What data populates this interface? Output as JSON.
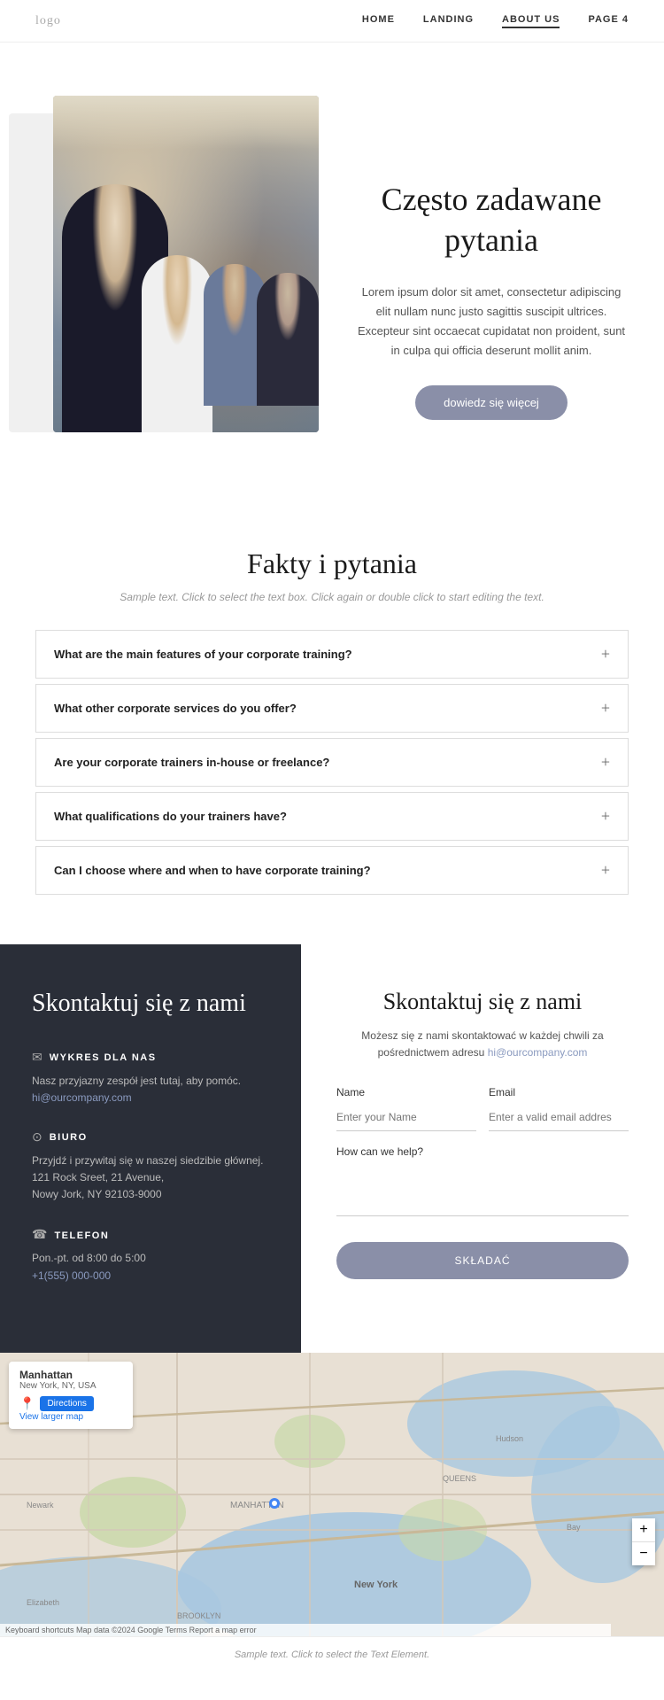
{
  "header": {
    "logo": "logo",
    "nav": {
      "home": "HOME",
      "landing": "LANDING",
      "about_us": "ABOUT US",
      "page4": "PAGE 4"
    }
  },
  "hero": {
    "title": "Często zadawane pytania",
    "body": "Lorem ipsum dolor sit amet, consectetur adipiscing elit nullam nunc justo sagittis suscipit ultrices. Excepteur sint occaecat cupidatat non proident, sunt in culpa qui officia deserunt mollit anim.",
    "button": "dowiedz się więcej"
  },
  "faq_section": {
    "title": "Fakty i pytania",
    "subtitle": "Sample text. Click to select the text box. Click again or double click to start editing the text.",
    "questions": [
      "What are the main features of your corporate training?",
      "What other corporate services do you offer?",
      "Are your corporate trainers in-house or freelance?",
      "What qualifications do your trainers have?",
      "Can I choose where and when to have corporate training?"
    ]
  },
  "contact_left": {
    "title": "Skontaktuj się z nami",
    "wykres": {
      "label": "WYKRES DLA NAS",
      "text": "Nasz przyjazny zespół jest tutaj, aby pomóc.",
      "link": "hi@ourcompany.com"
    },
    "biuro": {
      "label": "BIURO",
      "text": "Przyjdź i przywitaj się w naszej siedzibie głównej.",
      "address1": "121 Rock Sreet, 21 Avenue,",
      "address2": "Nowy Jork, NY 92103-9000"
    },
    "telefon": {
      "label": "TELEFON",
      "hours": "Pon.-pt. od 8:00 do 5:00",
      "number": "+1(555) 000-000"
    }
  },
  "contact_right": {
    "title": "Skontaktuj się z nami",
    "body": "Możesz się z nami skontaktować w każdej chwili za pośrednictwem adresu",
    "email_link": "hi@ourcompany.com",
    "name_label": "Name",
    "name_placeholder": "Enter your Name",
    "email_label": "Email",
    "email_placeholder": "Enter a valid email addres",
    "help_label": "How can we help?",
    "submit_button": "SKŁADAĆ"
  },
  "map": {
    "place": "Manhattan",
    "sub": "New York, NY, USA",
    "view_larger": "View larger map",
    "directions": "Directions",
    "footer": "Keyboard shortcuts  Map data ©2024 Google  Terms  Report a map error"
  },
  "footer": {
    "text": "Sample text. Click to select the Text Element."
  }
}
